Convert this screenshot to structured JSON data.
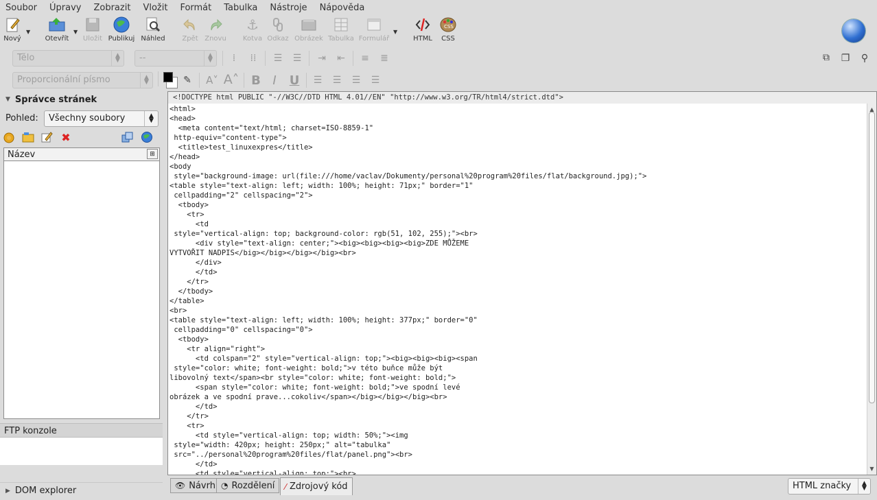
{
  "menu": [
    "Soubor",
    "Úpravy",
    "Zobrazit",
    "Vložit",
    "Formát",
    "Tabulka",
    "Nástroje",
    "Nápověda"
  ],
  "toolbar": {
    "buttons": [
      {
        "label": "Nový",
        "icon": "new-document-icon",
        "enabled": true
      },
      {
        "label": "Otevřít",
        "icon": "open-folder-icon",
        "enabled": true
      },
      {
        "label": "Uložit",
        "icon": "save-disk-icon",
        "enabled": false
      },
      {
        "label": "Publikuj",
        "icon": "publish-globe-icon",
        "enabled": true
      },
      {
        "label": "Náhled",
        "icon": "preview-magnifier-icon",
        "enabled": true
      },
      {
        "label": "Zpět",
        "icon": "undo-arrow-icon",
        "enabled": false
      },
      {
        "label": "Znovu",
        "icon": "redo-arrow-icon",
        "enabled": false
      },
      {
        "label": "Kotva",
        "icon": "anchor-icon",
        "enabled": false
      },
      {
        "label": "Odkaz",
        "icon": "link-chain-icon",
        "enabled": false
      },
      {
        "label": "Obrázek",
        "icon": "image-icon",
        "enabled": false
      },
      {
        "label": "Tabulka",
        "icon": "table-icon",
        "enabled": false
      },
      {
        "label": "Formulář",
        "icon": "form-icon",
        "enabled": false
      },
      {
        "label": "HTML",
        "icon": "html-tag-icon",
        "enabled": true
      },
      {
        "label": "CSS",
        "icon": "css-palette-icon",
        "enabled": true
      }
    ]
  },
  "format": {
    "paragraph_style": "Tělo",
    "list_style": "--",
    "font": "Proporcionální písmo"
  },
  "site_manager": {
    "title": "Správce stránek",
    "view_label": "Pohled:",
    "view_value": "Všechny soubory",
    "column_header": "Název"
  },
  "ftp_console": {
    "title": "FTP konzole"
  },
  "dom_explorer": {
    "title": "DOM explorer"
  },
  "editor": {
    "doctype": "<!DOCTYPE html PUBLIC \"-//W3C//DTD HTML 4.01//EN\" \"http://www.w3.org/TR/html4/strict.dtd\">",
    "lines": [
      "<html>",
      "<head>",
      "  <meta content=\"text/html; charset=ISO-8859-1\"",
      " http-equiv=\"content-type\">",
      "  <title>test_linuxexpres</title>",
      "</head>",
      "<body",
      " style=\"background-image: url(file:///home/vaclav/Dokumenty/personal%20program%20files/flat/background.jpg);\">",
      "<table style=\"text-align: left; width: 100%; height: 71px;\" border=\"1\"",
      " cellpadding=\"2\" cellspacing=\"2\">",
      "  <tbody>",
      "    <tr>",
      "      <td",
      " style=\"vertical-align: top; background-color: rgb(51, 102, 255);\"><br>",
      "      <div style=\"text-align: center;\"><big><big><big><big>ZDE MŮŽEME",
      "VYTVOŘIT NADPIS</big></big></big></big><br>",
      "      </div>",
      "      </td>",
      "    </tr>",
      "  </tbody>",
      "</table>",
      "<br>",
      "<table style=\"text-align: left; width: 100%; height: 377px;\" border=\"0\"",
      " cellpadding=\"0\" cellspacing=\"0\">",
      "  <tbody>",
      "    <tr align=\"right\">",
      "      <td colspan=\"2\" style=\"vertical-align: top;\"><big><big><big><span",
      " style=\"color: white; font-weight: bold;\">v této buňce může být",
      "libovolný text</span><br style=\"color: white; font-weight: bold;\">",
      "      <span style=\"color: white; font-weight: bold;\">ve spodní levé",
      "obrázek a ve spodní prave...cokoliv</span></big></big></big><br>",
      "      </td>",
      "    </tr>",
      "    <tr>",
      "      <td style=\"vertical-align: top; width: 50%;\"><img",
      " style=\"width: 420px; height: 250px;\" alt=\"tabulka\"",
      " src=\"../personal%20program%20files/flat/panel.png\"><br>",
      "      </td>",
      "      <td style=\"vertical-align: top;\"><br>"
    ]
  },
  "view_tabs": [
    "Návrh",
    "Rozdělení",
    "Zdrojový kód"
  ],
  "mode": "HTML značky",
  "colors": {
    "foreground": "#000000",
    "background": "#ffffff"
  }
}
